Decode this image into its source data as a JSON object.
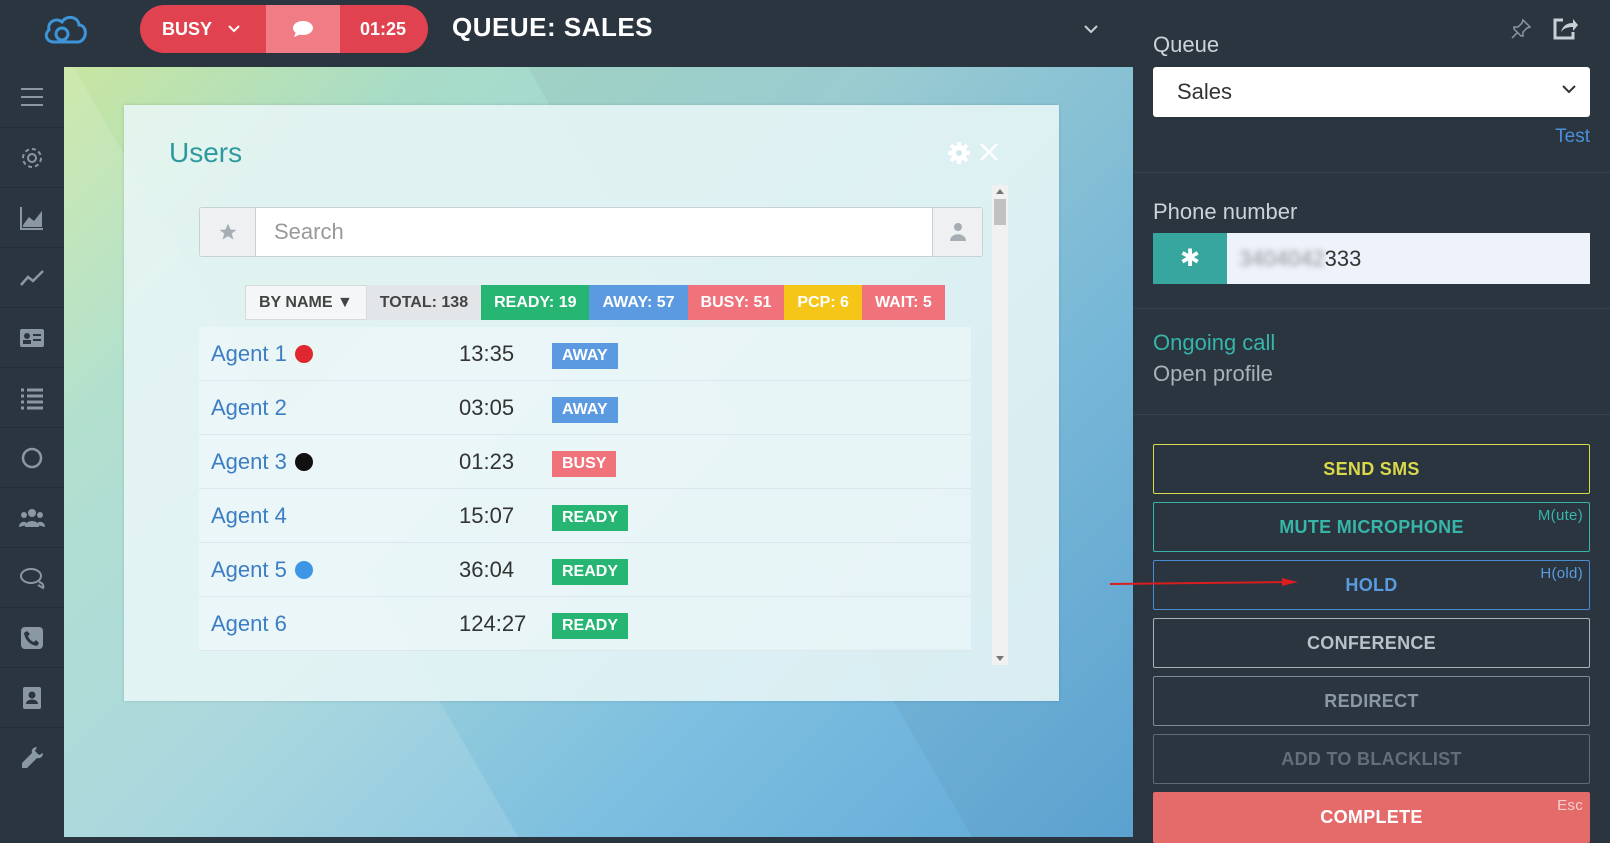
{
  "topbar": {
    "status_label": "BUSY",
    "timer": "01:25",
    "queue_title": "QUEUE: SALES"
  },
  "sidebar": {
    "items": [
      "menu-icon",
      "gear-icon",
      "chart-area-icon",
      "chart-line-icon",
      "contact-card-icon",
      "list-icon",
      "circle-icon",
      "users-icon",
      "chat-icon",
      "phone-icon",
      "address-book-icon",
      "wrench-icon"
    ]
  },
  "users_panel": {
    "title": "Users",
    "search_placeholder": "Search",
    "filters": {
      "by_name": "BY NAME ▼",
      "total": "TOTAL: 138",
      "ready": "READY: 19",
      "away": "AWAY: 57",
      "busy": "BUSY: 51",
      "pcp": "PCP: 6",
      "wait": "WAIT: 5"
    },
    "rows": [
      {
        "name": "Agent 1",
        "dot": "#e0262f",
        "time": "13:35",
        "status": "AWAY"
      },
      {
        "name": "Agent 2",
        "dot": "",
        "time": "03:05",
        "status": "AWAY"
      },
      {
        "name": "Agent 3",
        "dot": "#111111",
        "time": "01:23",
        "status": "BUSY"
      },
      {
        "name": "Agent 4",
        "dot": "",
        "time": "15:07",
        "status": "READY"
      },
      {
        "name": "Agent 5",
        "dot": "#3d95e6",
        "time": "36:04",
        "status": "READY"
      },
      {
        "name": "Agent 6",
        "dot": "",
        "time": "124:27",
        "status": "READY"
      }
    ]
  },
  "right_panel": {
    "queue_label": "Queue",
    "queue_value": "Sales",
    "test_link": "Test",
    "phone_label": "Phone number",
    "phone_prefix_button": "✱",
    "phone_hidden": "3404042",
    "phone_visible": "333",
    "ongoing_call": "Ongoing call",
    "open_profile": "Open profile",
    "actions": {
      "send_sms": "SEND SMS",
      "mute": "MUTE MICROPHONE",
      "mute_hotkey": "M(ute)",
      "hold": "HOLD",
      "hold_hotkey": "H(old)",
      "conference": "CONFERENCE",
      "redirect": "REDIRECT",
      "blacklist": "ADD TO BLACKLIST",
      "complete": "COMPLETE",
      "complete_hotkey": "Esc"
    }
  },
  "colors": {
    "accent_teal": "#36b5a8",
    "busy_red": "#e0434f",
    "ready_green": "#26b573",
    "away_blue": "#5b9ae0",
    "pcp_yellow": "#f5c518",
    "annotation_arrow": "#d81e1e"
  }
}
